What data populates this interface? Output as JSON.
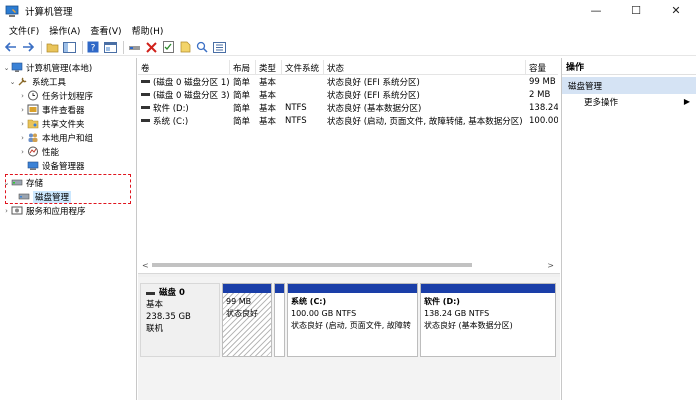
{
  "window": {
    "title": "计算机管理",
    "min_glyph": "—",
    "max_glyph": "☐",
    "close_glyph": "✕"
  },
  "menu": [
    "文件(F)",
    "操作(A)",
    "查看(V)",
    "帮助(H)"
  ],
  "toolbar": {
    "back_icon": "back-arrow-icon",
    "forward_icon": "forward-arrow-icon"
  },
  "tree": {
    "root": "计算机管理(本地)",
    "system_tools": "系统工具",
    "task_scheduler": "任务计划程序",
    "event_viewer": "事件查看器",
    "shared_folders": "共享文件夹",
    "local_users": "本地用户和组",
    "performance": "性能",
    "device_manager": "设备管理器",
    "storage": "存储",
    "disk_management": "磁盘管理",
    "services_apps": "服务和应用程序"
  },
  "volumes": {
    "headers": [
      "卷",
      "布局",
      "类型",
      "文件系统",
      "状态",
      "容量"
    ],
    "rows": [
      {
        "vol": "(磁盘 0 磁盘分区 1)",
        "layout": "简单",
        "type": "基本",
        "fs": "",
        "status": "状态良好 (EFI 系统分区)",
        "cap": "99 MB"
      },
      {
        "vol": "(磁盘 0 磁盘分区 3)",
        "layout": "简单",
        "type": "基本",
        "fs": "",
        "status": "状态良好 (EFI 系统分区)",
        "cap": "2 MB"
      },
      {
        "vol": "软件 (D:)",
        "layout": "简单",
        "type": "基本",
        "fs": "NTFS",
        "status": "状态良好 (基本数据分区)",
        "cap": "138.24"
      },
      {
        "vol": "系统 (C:)",
        "layout": "简单",
        "type": "基本",
        "fs": "NTFS",
        "status": "状态良好 (启动, 页面文件, 故障转储, 基本数据分区)",
        "cap": "100.00"
      }
    ],
    "scroll_left": "<",
    "scroll_right": ">"
  },
  "disk": {
    "name": "磁盘 0",
    "type": "基本",
    "size": "238.35 GB",
    "status": "联机",
    "partitions": [
      {
        "name": "",
        "size": "99 MB",
        "status": "状态良好"
      },
      {
        "name": "",
        "size": "",
        "status": ""
      },
      {
        "name": "系统  (C:)",
        "size": "100.00 GB NTFS",
        "status": "状态良好 (启动, 页面文件, 故障转"
      },
      {
        "name": "软件  (D:)",
        "size": "138.24 GB NTFS",
        "status": "状态良好 (基本数据分区)"
      }
    ]
  },
  "actions": {
    "header": "操作",
    "section": "磁盘管理",
    "more": "更多操作",
    "more_arrow": "▶"
  },
  "colors": {
    "partition_bar": "#1a3ea8",
    "selected_bg": "#cce8ff",
    "highlight_dashed": "#e0141e",
    "actions_section_bg": "#d5e3f4"
  }
}
